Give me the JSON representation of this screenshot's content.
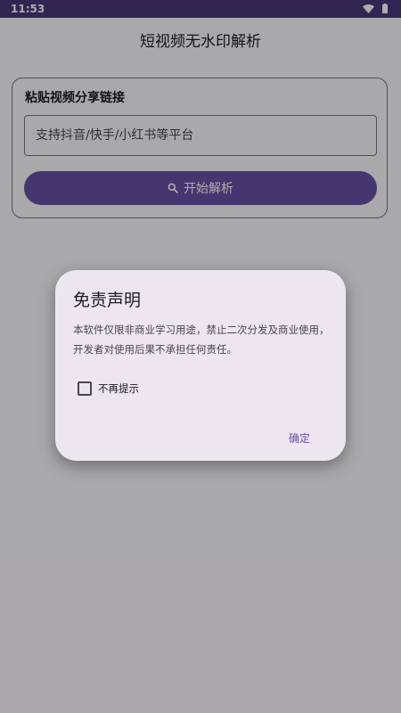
{
  "status_bar": {
    "time": "11:53",
    "icons": [
      "wifi-icon",
      "battery-icon"
    ]
  },
  "app": {
    "title": "短视频无水印解析"
  },
  "card": {
    "title": "粘贴视频分享链接",
    "input": {
      "placeholder": "支持抖音/快手/小红书等平台",
      "value": ""
    },
    "parse_button": {
      "icon": "search-icon",
      "label": "开始解析"
    }
  },
  "dialog": {
    "title": "免责声明",
    "body": "本软件仅限非商业学习用途，禁止二次分发及商业使用，开发者对使用后果不承担任何责任。",
    "checkbox": {
      "label": "不再提示",
      "checked": false
    },
    "confirm_label": "确定"
  },
  "colors": {
    "status_bar": "#49397a",
    "primary": "#6750a4",
    "dialog_surface": "#ece6f0",
    "outline": "#79747e"
  }
}
